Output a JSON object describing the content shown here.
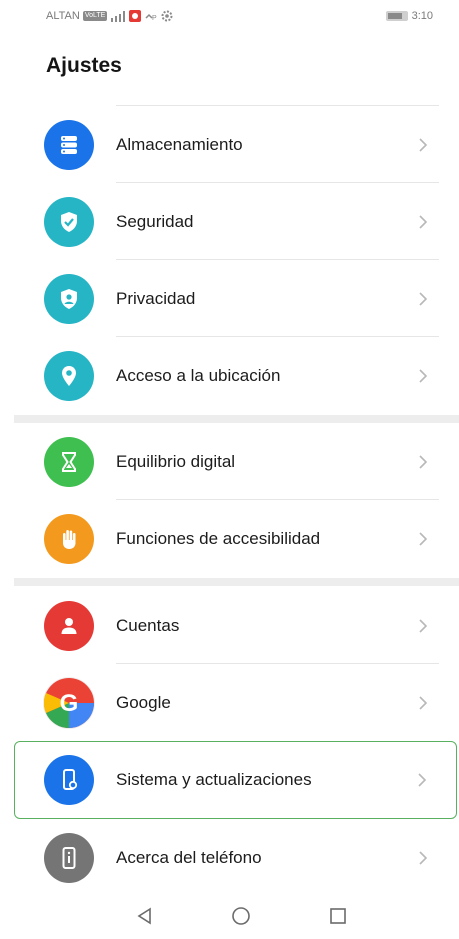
{
  "status_bar": {
    "carrier": "ALTAN",
    "volte_badge": "VoLTE",
    "time": "3:10",
    "icons": [
      "volte-badge",
      "signal-icon",
      "notification-app-icon",
      "wifi-calling-icon",
      "settings-gear-icon",
      "battery-icon"
    ]
  },
  "header": {
    "title": "Ajustes"
  },
  "settings": {
    "items": [
      {
        "label": "Almacenamiento",
        "icon": "storage-icon",
        "color": "#1a73e8"
      },
      {
        "label": "Seguridad",
        "icon": "shield-check-icon",
        "color": "#26b5c5"
      },
      {
        "label": "Privacidad",
        "icon": "privacy-shield-icon",
        "color": "#26b5c5"
      },
      {
        "label": "Acceso a la ubicación",
        "icon": "location-pin-icon",
        "color": "#26b5c5"
      },
      {
        "label": "Equilibrio digital",
        "icon": "hourglass-icon",
        "color": "#3fbf4f"
      },
      {
        "label": "Funciones de accesibilidad",
        "icon": "hand-icon",
        "color": "#f39a1e"
      },
      {
        "label": "Cuentas",
        "icon": "account-person-icon",
        "color": "#e53935"
      },
      {
        "label": "Google",
        "icon": "google-logo-icon",
        "color": "#ffffff"
      },
      {
        "label": "Sistema y actualizaciones",
        "icon": "system-phone-gear-icon",
        "color": "#1a73e8"
      },
      {
        "label": "Acerca del teléfono",
        "icon": "phone-info-icon",
        "color": "#757575"
      }
    ]
  },
  "navigation": {
    "buttons": [
      "back-icon",
      "home-icon",
      "recents-icon"
    ]
  }
}
